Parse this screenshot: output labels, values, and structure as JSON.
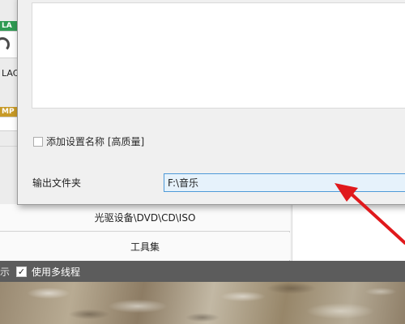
{
  "left_strip": {
    "format_tiles": [
      {
        "label": "LA",
        "color": "#2f9a52"
      },
      {
        "label": "",
        "color": "#2f9a52"
      }
    ],
    "format_text": "LAC",
    "mp_tile_label": "MP"
  },
  "bottom_panel": {
    "rows": [
      {
        "label": "光驱设备\\DVD\\CD\\ISO"
      },
      {
        "label": "工具集"
      }
    ]
  },
  "status_bar": {
    "cut_text": "示",
    "checkbox_checked": true,
    "checkbox_glyph": "✓",
    "multithread_label": "使用多线程"
  },
  "dialog": {
    "add_setting_name_checked": false,
    "add_setting_name_label": "添加设置名称 [高质量]",
    "output_folder_label": "输出文件夹",
    "output_folder_value": "F:\\音乐"
  },
  "annotation": {
    "arrow_color": "#e0191c"
  }
}
